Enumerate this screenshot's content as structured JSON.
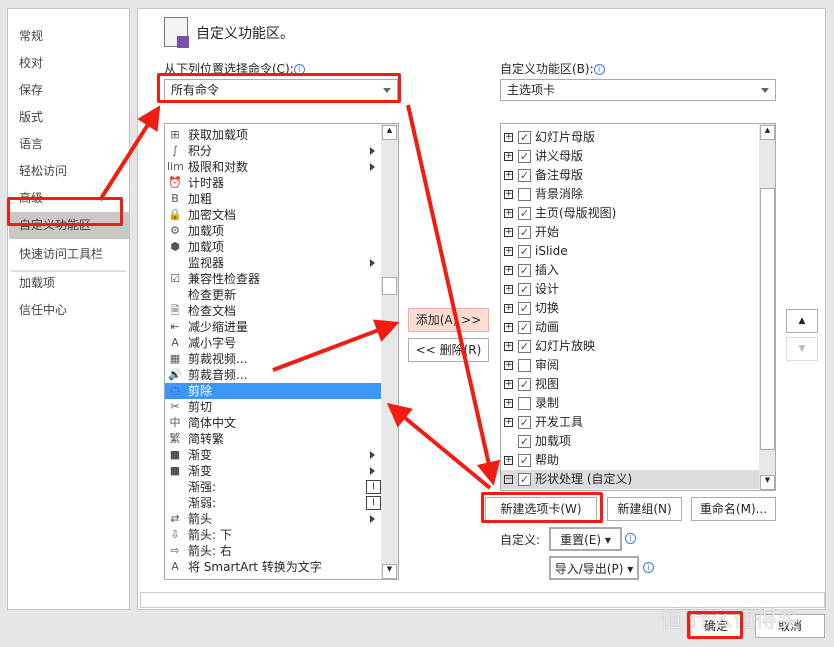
{
  "nav": {
    "items": [
      "常规",
      "校对",
      "保存",
      "版式",
      "语言",
      "轻松访问",
      "高级",
      "自定义功能区",
      "快速访问工具栏",
      "加载项",
      "信任中心"
    ],
    "selected": "自定义功能区"
  },
  "header": {
    "title": "自定义功能区。"
  },
  "left": {
    "label": "从下列位置选择命令(C):",
    "dropdown": "所有命令",
    "items": [
      {
        "t": "获取加载项",
        "i": "⊞"
      },
      {
        "t": "积分",
        "i": "∫",
        "sub": true
      },
      {
        "t": "极限和对数",
        "i": "lim",
        "sub": true
      },
      {
        "t": "计时器",
        "i": "⏰"
      },
      {
        "t": "加粗",
        "i": "B"
      },
      {
        "t": "加密文档",
        "i": "🔒"
      },
      {
        "t": "加载项",
        "i": "⚙"
      },
      {
        "t": "加载项",
        "i": "⬢"
      },
      {
        "t": "监视器",
        "i": "",
        "sub": true
      },
      {
        "t": "兼容性检查器",
        "i": "☑"
      },
      {
        "t": "检查更新",
        "i": ""
      },
      {
        "t": "检查文档",
        "i": "🗎"
      },
      {
        "t": "减少缩进量",
        "i": "⇤"
      },
      {
        "t": "减小字号",
        "i": "A"
      },
      {
        "t": "剪裁视频...",
        "i": "▦"
      },
      {
        "t": "剪裁音频...",
        "i": "🔊"
      },
      {
        "t": "剪除",
        "i": "◌",
        "sel": true
      },
      {
        "t": "剪切",
        "i": "✂"
      },
      {
        "t": "简体中文",
        "i": "中"
      },
      {
        "t": "简转繁",
        "i": "繁"
      },
      {
        "t": "渐变",
        "i": "■",
        "sub": true
      },
      {
        "t": "渐变",
        "i": "■",
        "sub": true
      },
      {
        "t": "渐强:",
        "i": "",
        "tb": true
      },
      {
        "t": "渐弱:",
        "i": "",
        "tb": true
      },
      {
        "t": "箭头",
        "i": "⇄",
        "sub": true
      },
      {
        "t": "箭头: 下",
        "i": "⇩"
      },
      {
        "t": "箭头: 右",
        "i": "⇨"
      },
      {
        "t": "将 SmartArt 转换为文字",
        "i": "A"
      }
    ]
  },
  "mid": {
    "add": "添加(A) >>",
    "remove": "<< 删除(R)"
  },
  "right": {
    "label": "自定义功能区(B):",
    "dropdown": "主选项卡",
    "items": [
      {
        "t": "幻灯片母版",
        "c": true,
        "p": "+"
      },
      {
        "t": "讲义母版",
        "c": true,
        "p": "+"
      },
      {
        "t": "备注母版",
        "c": true,
        "p": "+"
      },
      {
        "t": "背景消除",
        "c": false,
        "p": "+"
      },
      {
        "t": "主页(母版视图)",
        "c": true,
        "p": "+"
      },
      {
        "t": "开始",
        "c": true,
        "p": "+"
      },
      {
        "t": "iSlide",
        "c": true,
        "p": "+"
      },
      {
        "t": "插入",
        "c": true,
        "p": "+"
      },
      {
        "t": "设计",
        "c": true,
        "p": "+"
      },
      {
        "t": "切换",
        "c": true,
        "p": "+"
      },
      {
        "t": "动画",
        "c": true,
        "p": "+"
      },
      {
        "t": "幻灯片放映",
        "c": true,
        "p": "+"
      },
      {
        "t": "审阅",
        "c": false,
        "p": "+"
      },
      {
        "t": "视图",
        "c": true,
        "p": "+"
      },
      {
        "t": "录制",
        "c": false,
        "p": "+"
      },
      {
        "t": "开发工具",
        "c": true,
        "p": "+"
      },
      {
        "t": "加载项",
        "c": true,
        "p": ""
      },
      {
        "t": "帮助",
        "c": true,
        "p": "+"
      },
      {
        "t": "形状处理 (自定义)",
        "c": true,
        "p": "−",
        "sel": true
      }
    ],
    "new_tab": "新建选项卡(W)",
    "new_group": "新建组(N)",
    "rename": "重命名(M)...",
    "customize_label": "自定义:",
    "reset": "重置(E) ▾",
    "import_export": "导入/导出(P) ▾"
  },
  "footer": {
    "ok": "确定",
    "cancel": "取消"
  },
  "watermark": "值 什么值得买",
  "colors": {
    "highlight": "#f21c12",
    "selection": "#3b97f5"
  }
}
